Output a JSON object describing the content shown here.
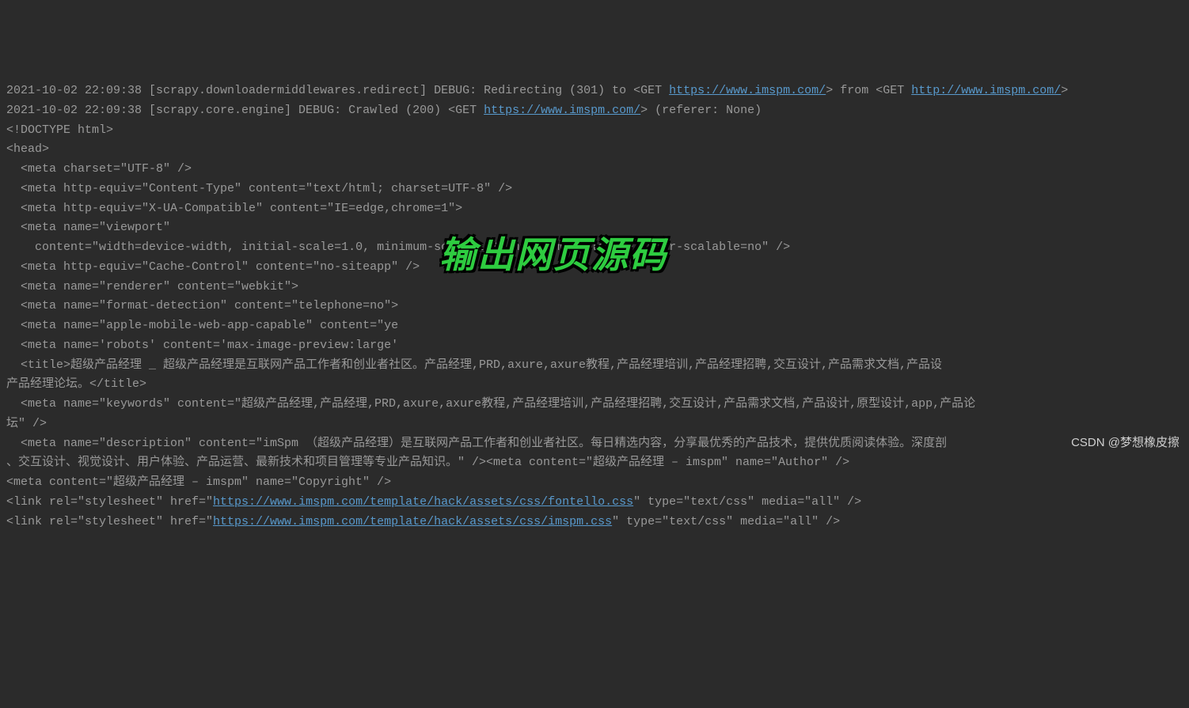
{
  "log": {
    "line1_prefix": "2021-10-02 22:09:38 [scrapy.downloadermiddlewares.redirect] DEBUG: Redirecting (301) to <GET ",
    "line1_url1": "https://www.imspm.com/",
    "line1_mid": "> from <GET ",
    "line1_url2": "http://www.imspm.com/",
    "line1_suffix": ">",
    "line2_prefix": "2021-10-02 22:09:38 [scrapy.core.engine] DEBUG: Crawled (200) <GET ",
    "line2_url": "https://www.imspm.com/",
    "line2_suffix": "> (referer: None)"
  },
  "html_source": {
    "l01": "<!DOCTYPE html>",
    "l02": "<head>",
    "l03": "  <meta charset=\"UTF-8\" />",
    "l04": "  <meta http-equiv=\"Content-Type\" content=\"text/html; charset=UTF-8\" />",
    "l05": "  <meta http-equiv=\"X-UA-Compatible\" content=\"IE=edge,chrome=1\">",
    "l06": "  <meta name=\"viewport\"",
    "l07": "    content=\"width=device-width, initial-scale=1.0, minimum-scale=1.0, maximum-scale=1.0, user-scalable=no\" />",
    "l08": "  <meta http-equiv=\"Cache-Control\" content=\"no-siteapp\" />",
    "l09": "  <meta name=\"renderer\" content=\"webkit\">",
    "l10": "  <meta name=\"format-detection\" content=\"telephone=no\">",
    "l11": "  <meta name=\"apple-mobile-web-app-capable\" content=\"ye",
    "l12": "  <meta name='robots' content='max-image-preview:large'",
    "l13": "  <title>超级产品经理 _ 超级产品经理是互联网产品工作者和创业者社区。产品经理,PRD,axure,axure教程,产品经理培训,产品经理招聘,交互设计,产品需求文档,产品设",
    "l14": "产品经理论坛。</title>",
    "l15": "  <meta name=\"keywords\" content=\"超级产品经理,产品经理,PRD,axure,axure教程,产品经理培训,产品经理招聘,交互设计,产品需求文档,产品设计,原型设计,app,产品论",
    "l16": "坛\" />",
    "l17": "  <meta name=\"description\" content=\"imSpm （超级产品经理）是互联网产品工作者和创业者社区。每日精选内容，分享最优秀的产品技术，提供优质阅读体验。深度剖",
    "l18": "、交互设计、视觉设计、用户体验、产品运营、最新技术和项目管理等专业产品知识。\" /><meta content=\"超级产品经理 – imspm\" name=\"Author\" />",
    "l19": "<meta content=\"超级产品经理 – imspm\" name=\"Copyright\" />",
    "l20_prefix": "<link rel=\"stylesheet\" href=\"",
    "l20_url": "https://www.imspm.com/template/hack/assets/css/fontello.css",
    "l20_suffix": "\" type=\"text/css\" media=\"all\" />",
    "l21_prefix": "<link rel=\"stylesheet\" href=\"",
    "l21_url": "https://www.imspm.com/template/hack/assets/css/imspm.css",
    "l21_suffix": "\" type=\"text/css\" media=\"all\" />"
  },
  "overlay": {
    "text": "输出网页源码"
  },
  "watermark": {
    "text": "CSDN @梦想橡皮擦"
  }
}
